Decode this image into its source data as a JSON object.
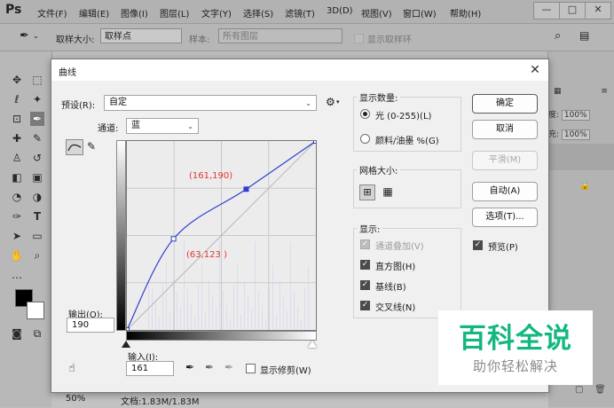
{
  "app": {
    "logo": "Ps",
    "menu": [
      "文件(F)",
      "编辑(E)",
      "图像(I)",
      "图层(L)",
      "文字(Y)",
      "选择(S)",
      "滤镜(T)",
      "3D(D)",
      "视图(V)",
      "窗口(W)",
      "帮助(H)"
    ],
    "window_controls": [
      "—",
      "□",
      "✕"
    ]
  },
  "options_bar": {
    "sample_size_label": "取样大小:",
    "sample_size_value": "取样点",
    "sample_label": "样本:",
    "sample_value": "所有图层",
    "show_ring_label": "显示取样环"
  },
  "document": {
    "zoom": "50%",
    "doc_info": "文档:1.83M/1.83M"
  },
  "right_panel": {
    "opacity_label": "度:",
    "opacity_value": "100%",
    "fill_label": "充:",
    "fill_value": "100%"
  },
  "dialog": {
    "title": "曲线",
    "preset_label": "预设(R):",
    "preset_value": "自定",
    "channel_label": "通道:",
    "channel_value": "蓝",
    "output_label": "输出(O):",
    "output_value": "190",
    "input_label": "输入(I):",
    "input_value": "161",
    "show_clipping_label": "显示修剪(W)",
    "annotations": [
      "(161,190)",
      "(63,123 )"
    ],
    "show_amount": {
      "title": "显示数量:",
      "light": "光 (0-255)(L)",
      "pigment": "颜料/油墨 %(G)"
    },
    "grid_size_title": "网格大小:",
    "display": {
      "title": "显示:",
      "channel_overlays": "通道叠加(V)",
      "histogram": "直方图(H)",
      "baseline": "基线(B)",
      "intersection": "交叉线(N)"
    },
    "buttons": {
      "ok": "确定",
      "cancel": "取消",
      "smooth": "平滑(M)",
      "auto": "自动(A)",
      "options": "选项(T)...",
      "preview": "预览(P)"
    },
    "curve_points": [
      [
        0,
        0
      ],
      [
        63,
        123
      ],
      [
        161,
        190
      ],
      [
        255,
        255
      ]
    ]
  },
  "watermark": {
    "title": "百科全说",
    "subtitle": "助你轻松解决"
  },
  "colors": {
    "curve": "#2f3fd1",
    "watermark_green": "#14b87e"
  }
}
